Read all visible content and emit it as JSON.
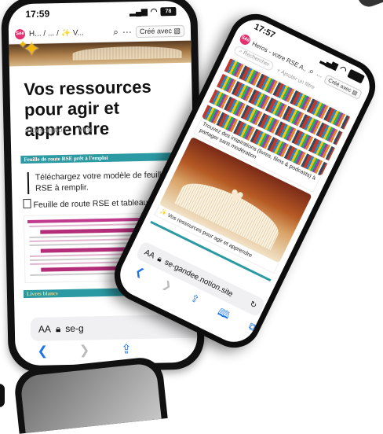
{
  "phone_back": {
    "status": {
      "time": "17:59",
      "battery": "78"
    },
    "topbar": {
      "logo": "Séé",
      "crumb_1": "H...",
      "crumb_sep_1": "/",
      "crumb_2": "...",
      "crumb_sep_2": "/",
      "crumb_3": "V...",
      "cree_label": "Créé avec"
    },
    "page": {
      "title": "Vos ressources pour agir et apprendre",
      "prop_label": "Description",
      "prop_value": "Vide",
      "banner": "Feuille de route RSE prêt à l'emploi",
      "quote": "Téléchargez votre modèle de feuille de route RSE à remplir.",
      "file": "Feuille de route RSE et tableau",
      "livres_a": "Livres",
      "livres_b": "blancs"
    },
    "url": {
      "aa": "AA",
      "text": "se-g"
    }
  },
  "phone_front": {
    "status": {
      "time": "17:57"
    },
    "topbar": {
      "logo": "Séé",
      "title": "Heros - votre RSE A...",
      "cree_label": "Créé avec"
    },
    "search": {
      "placeholder": "Rechercher",
      "filter": "+ Ajouter un filtre"
    },
    "cards": [
      {
        "caption": "Trouvez des inspirations (livres, films & podcasts) à partager sans modération"
      },
      {
        "caption": "Vos ressources pour agir et apprendre"
      }
    ],
    "url": {
      "aa": "AA",
      "text": "se-gandee.notion.site"
    }
  },
  "colors": {
    "teal": "#2c9aa3",
    "pink": "#e2316f",
    "link_blue": "#1a73e8",
    "spark": "#f2b705"
  }
}
